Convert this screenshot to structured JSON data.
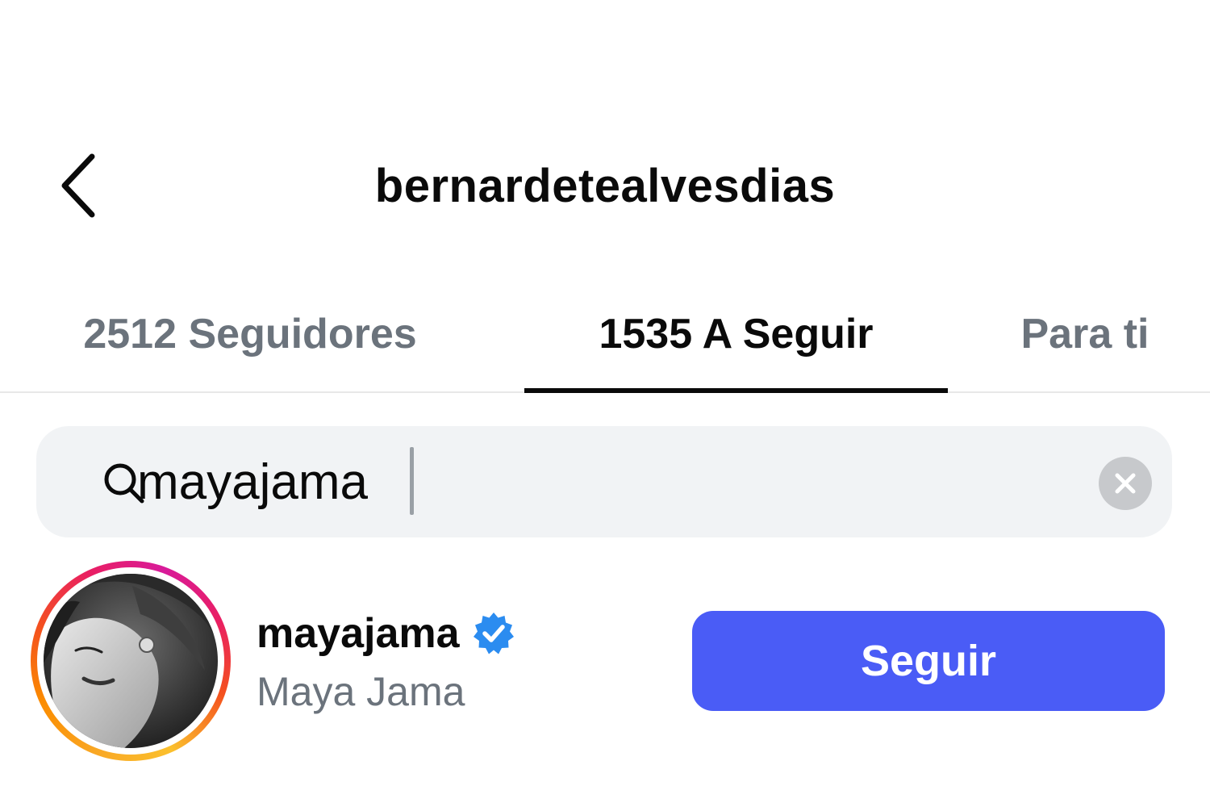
{
  "header": {
    "title": "bernardetealvesdias",
    "back_icon": "chevron-left-icon"
  },
  "tabs": [
    {
      "label": "2512 Seguidores",
      "active": false
    },
    {
      "label": "1535 A Seguir",
      "active": true
    },
    {
      "label": "Para ti",
      "active": false
    }
  ],
  "search": {
    "value": "mayajama",
    "icon": "search-icon",
    "clear_icon": "clear-icon"
  },
  "results": [
    {
      "username": "mayajama",
      "full_name": "Maya Jama",
      "verified": true,
      "follow_label": "Seguir"
    }
  ],
  "colors": {
    "text_primary": "#0a0a0a",
    "text_secondary": "#6b737c",
    "search_bg": "#f1f3f5",
    "follow_button": "#4a5cf6",
    "verified_badge": "#2b8cf0",
    "tab_indicator": "#0a0a0a"
  }
}
